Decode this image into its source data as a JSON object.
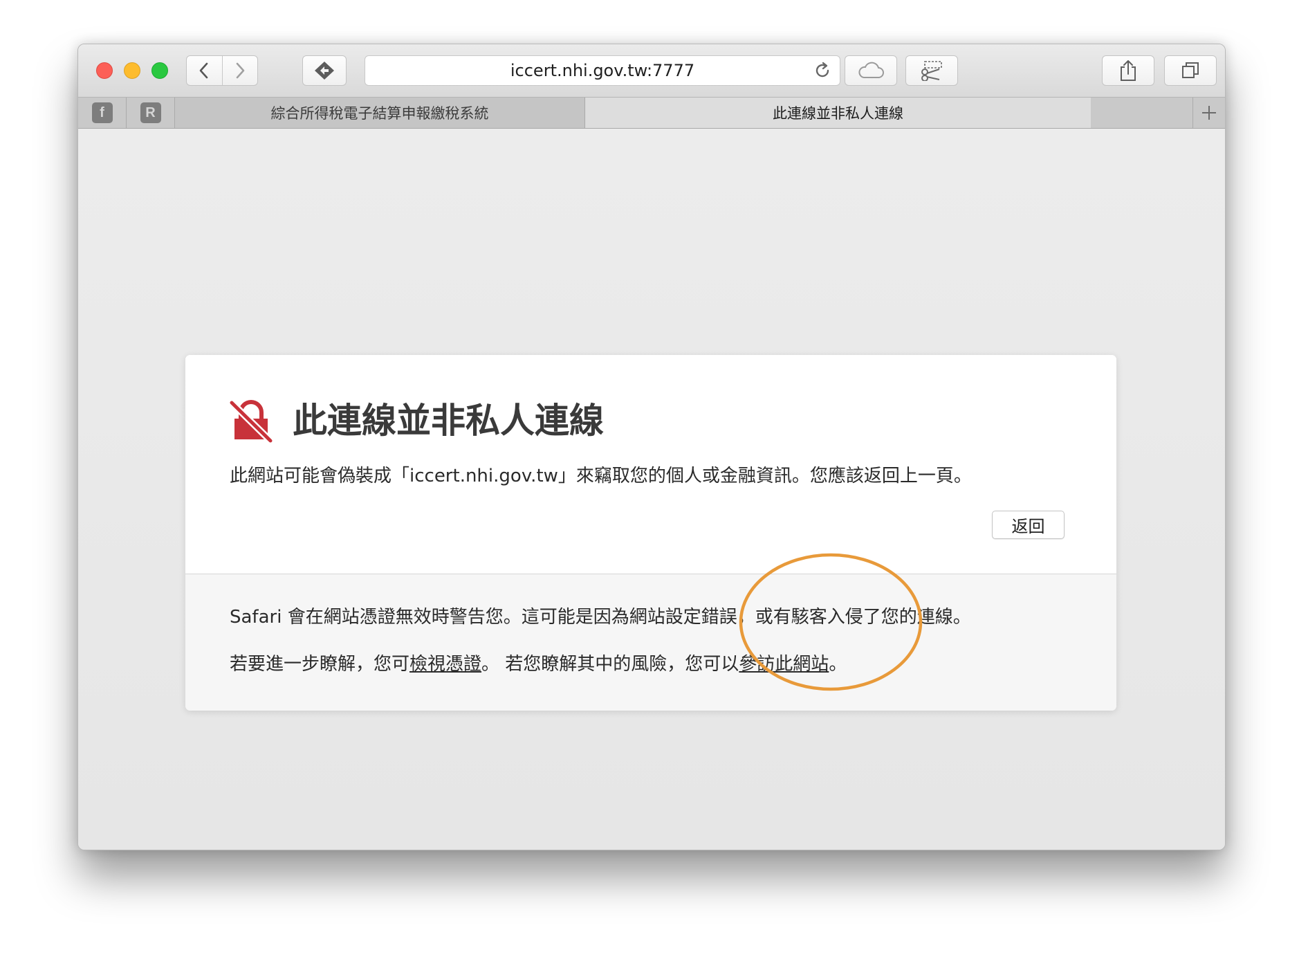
{
  "browser": {
    "url": "iccert.nhi.gov.tw:7777",
    "tabs": [
      {
        "label": "綜合所得稅電子結算申報繳稅系統",
        "active": false
      },
      {
        "label": "此連線並非私人連線",
        "active": true
      }
    ],
    "pinned_tabs": [
      {
        "glyph": "f",
        "icon": "facebook-icon"
      },
      {
        "glyph": "R",
        "icon": "r-extension-icon"
      }
    ]
  },
  "warning": {
    "title": "此連線並非私人連線",
    "description": "此網站可能會偽裝成「iccert.nhi.gov.tw」來竊取您的個人或金融資訊。您應該返回上一頁。",
    "back_label": "返回",
    "info_line1": "Safari 會在網站憑證無效時警告您。這可能是因為網站設定錯誤，或有駭客入侵了您的連線。",
    "info_line2_prefix": "若要進一步瞭解，您可",
    "view_cert_link": "檢視憑證",
    "info_line2_middle": "。 若您瞭解其中的風險，您可以",
    "visit_site_link": "參訪此網站",
    "info_line2_suffix": "。"
  },
  "colors": {
    "warning_icon": "#c8323a",
    "annotation_circle": "#e89a3a"
  }
}
